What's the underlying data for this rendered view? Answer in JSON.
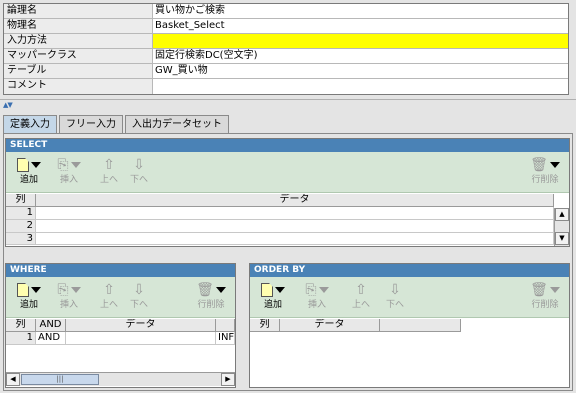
{
  "properties": [
    {
      "key": "論理名",
      "value": "買い物かご検索"
    },
    {
      "key": "物理名",
      "value": "Basket_Select"
    },
    {
      "key": "入力方法",
      "value": ""
    },
    {
      "key": "マッパークラス",
      "value": "固定行検索DC(空文字)"
    },
    {
      "key": "テーブル",
      "value": "GW_買い物"
    },
    {
      "key": "コメント",
      "value": ""
    }
  ],
  "tabs": [
    {
      "label": "定義入力"
    },
    {
      "label": "フリー入力"
    },
    {
      "label": "入出力データセット"
    }
  ],
  "toolbar": {
    "add": "追加",
    "insert": "挿入",
    "up": "上へ",
    "down": "下へ",
    "delete_row": "行削除"
  },
  "select_panel": {
    "title": "SELECT",
    "columns": [
      "列",
      "データ"
    ],
    "row_numbers": [
      "1",
      "2",
      "3"
    ]
  },
  "where_panel": {
    "title": "WHERE",
    "columns": [
      "列",
      "AND",
      "データ"
    ],
    "rows": [
      {
        "num": "1",
        "and": "AND",
        "data": "",
        "extra": "INF"
      }
    ]
  },
  "orderby_panel": {
    "title": "ORDER BY",
    "columns": [
      "列",
      "データ"
    ]
  },
  "colors": {
    "header_blue": "#4a82b6",
    "toolbar_green": "#d6e6d6",
    "highlight_yellow": "#ffff00"
  }
}
